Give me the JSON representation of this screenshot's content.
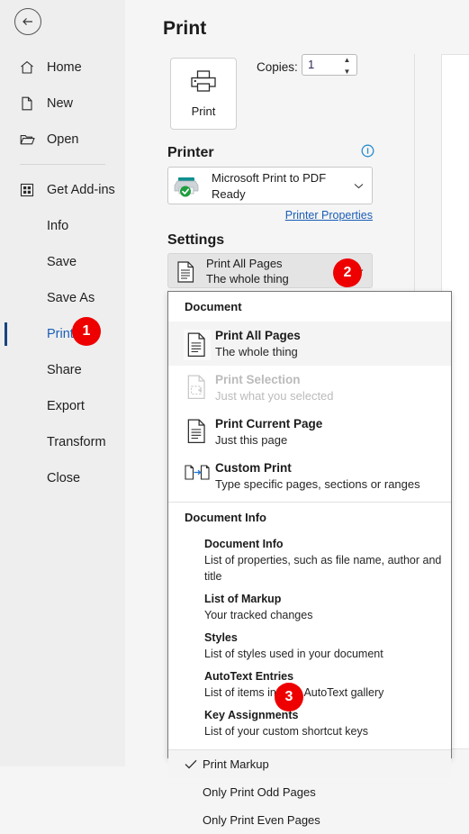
{
  "app": {
    "back_label": "Back",
    "page_title": "Print"
  },
  "sidebar": {
    "items": [
      {
        "label": "Home",
        "icon": "home-icon",
        "has_icon": true,
        "selected": false
      },
      {
        "label": "New",
        "icon": "new-document-icon",
        "has_icon": true,
        "selected": false
      },
      {
        "label": "Open",
        "icon": "folder-open-icon",
        "has_icon": true,
        "selected": false
      },
      {
        "label": "Get Add-ins",
        "icon": "add-ins-grid-icon",
        "has_icon": true,
        "selected": false
      },
      {
        "label": "Info",
        "icon": "",
        "has_icon": false,
        "selected": false
      },
      {
        "label": "Save",
        "icon": "",
        "has_icon": false,
        "selected": false
      },
      {
        "label": "Save As",
        "icon": "",
        "has_icon": false,
        "selected": false
      },
      {
        "label": "Print",
        "icon": "",
        "has_icon": false,
        "selected": true
      },
      {
        "label": "Share",
        "icon": "",
        "has_icon": false,
        "selected": false
      },
      {
        "label": "Export",
        "icon": "",
        "has_icon": false,
        "selected": false
      },
      {
        "label": "Transform",
        "icon": "",
        "has_icon": false,
        "selected": false
      },
      {
        "label": "Close",
        "icon": "",
        "has_icon": false,
        "selected": false
      }
    ]
  },
  "print": {
    "button_label": "Print",
    "copies_label": "Copies:",
    "copies_value": "1",
    "printer_heading": "Printer",
    "printer_name": "Microsoft Print to PDF",
    "printer_status": "Ready",
    "printer_properties_link": "Printer Properties",
    "settings_heading": "Settings",
    "settings_selected_title": "Print All Pages",
    "settings_selected_sub": "The whole thing"
  },
  "dropdown": {
    "group_document_label": "Document",
    "document_items": [
      {
        "title": "Print All Pages",
        "sub": "The whole thing",
        "icon": "page-all-icon",
        "selected": true,
        "disabled": false
      },
      {
        "title": "Print Selection",
        "sub": "Just what you selected",
        "icon": "page-selection-icon",
        "selected": false,
        "disabled": true
      },
      {
        "title": "Print Current Page",
        "sub": "Just this page",
        "icon": "page-current-icon",
        "selected": false,
        "disabled": false
      },
      {
        "title": "Custom Print",
        "sub": "Type specific pages, sections or ranges",
        "icon": "custom-print-icon",
        "selected": false,
        "disabled": false
      }
    ],
    "group_document_info_label": "Document Info",
    "document_info_items": [
      {
        "title": "Document Info",
        "sub": "List of properties, such as file name, author and title"
      },
      {
        "title": "List of Markup",
        "sub": "Your tracked changes"
      },
      {
        "title": "Styles",
        "sub": "List of styles used in your document"
      },
      {
        "title": "AutoText Entries",
        "sub": "List of items in your AutoText gallery"
      },
      {
        "title": "Key Assignments",
        "sub": "List of your custom shortcut keys"
      }
    ],
    "toggle_items": [
      {
        "label": "Print Markup",
        "checked": true,
        "highlight": true
      },
      {
        "label": "Only Print Odd Pages",
        "checked": false,
        "highlight": false
      },
      {
        "label": "Only Print Even Pages",
        "checked": false,
        "highlight": false
      }
    ]
  },
  "badges": [
    {
      "number": "1"
    },
    {
      "number": "2"
    },
    {
      "number": "3"
    }
  ],
  "colors": {
    "accent_blue": "#1b5eb5",
    "badge_red": "#ee0000",
    "nav_bg": "#eeeeee",
    "pane_bg": "#f5f5f5"
  }
}
